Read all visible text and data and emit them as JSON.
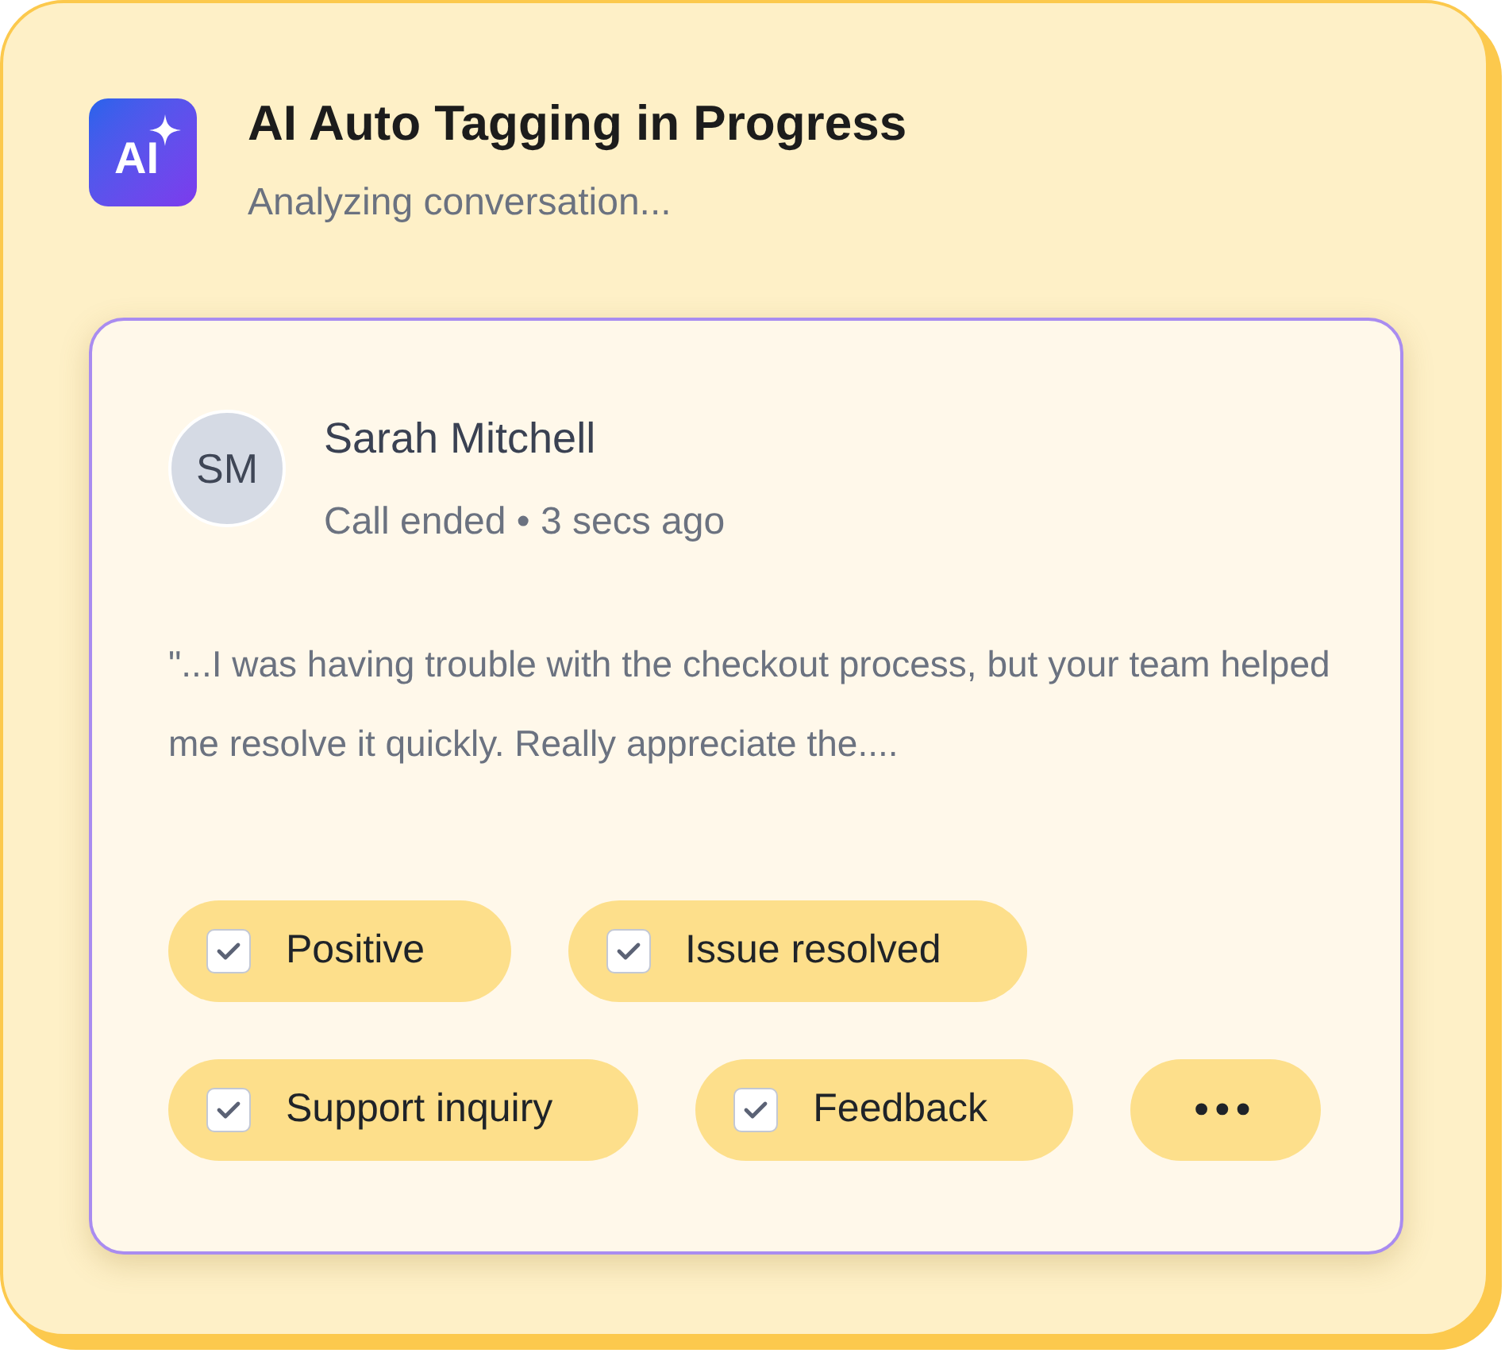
{
  "header": {
    "logo_text": "AI",
    "title": "AI Auto Tagging in Progress",
    "subtitle": "Analyzing conversation..."
  },
  "conversation": {
    "avatar_initials": "SM",
    "name": "Sarah Mitchell",
    "status": "Call ended • 3 secs ago",
    "quote": "\"...I was having trouble with the checkout process, but your team helped me resolve it quickly. Really appreciate the....",
    "tag_rows": [
      [
        {
          "kind": "tag",
          "label": "Positive",
          "checked": true
        },
        {
          "kind": "tag",
          "label": "Issue resolved",
          "checked": true
        }
      ],
      [
        {
          "kind": "tag",
          "label": "Support inquiry",
          "checked": true
        },
        {
          "kind": "tag",
          "label": "Feedback",
          "checked": true
        },
        {
          "kind": "more",
          "label": "•••"
        }
      ]
    ]
  }
}
